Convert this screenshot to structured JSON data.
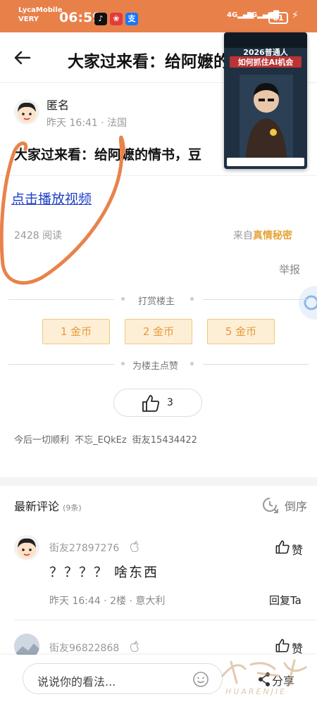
{
  "status_bar": {
    "carrier_line1": "LycaMobile",
    "carrier_line2": "VERY",
    "time": "06:59",
    "network_4g": "4G",
    "network_5g": "5G",
    "battery": "81"
  },
  "header": {
    "title": "大家过来看：给阿嬷的情书，豆"
  },
  "pip": {
    "headline1": "2026普通人",
    "headline2": "如何抓住AI机会"
  },
  "post": {
    "author": "匿名",
    "meta": "昨天 16:41 · 法国",
    "title": "大家过来看：给阿嬷的情书，豆",
    "video_link": "点击播放视频",
    "reads": "2428 阅读",
    "source_prefix": "来自",
    "source_name": "真情秘密",
    "report": "举报"
  },
  "reward": {
    "title": "打赏楼主",
    "coins": [
      "1 金币",
      "2 金币",
      "5 金币"
    ]
  },
  "like_section": {
    "title": "为楼主点赞",
    "count": "3",
    "likers": "今后一切顺利 不忘_EQkEz 街友15434422"
  },
  "comments": {
    "title": "最新评论",
    "count": "(9条)",
    "sort_label": "倒序",
    "items": [
      {
        "user": "街友27897276",
        "text": "？？？？ 啥东西",
        "meta": "昨天 16:44 · 2楼 · 意大利",
        "like_label": "赞",
        "reply_label": "回复Ta"
      },
      {
        "user": "街友96822868",
        "like_label": "赞"
      }
    ]
  },
  "bottom_bar": {
    "placeholder": "说说你的看法...",
    "share_label": "分享"
  },
  "watermark": {
    "text": "HUARENJIE"
  },
  "colors": {
    "status_bar": "#e8804a",
    "accent": "#e79a3a",
    "link": "#1e40c8"
  }
}
